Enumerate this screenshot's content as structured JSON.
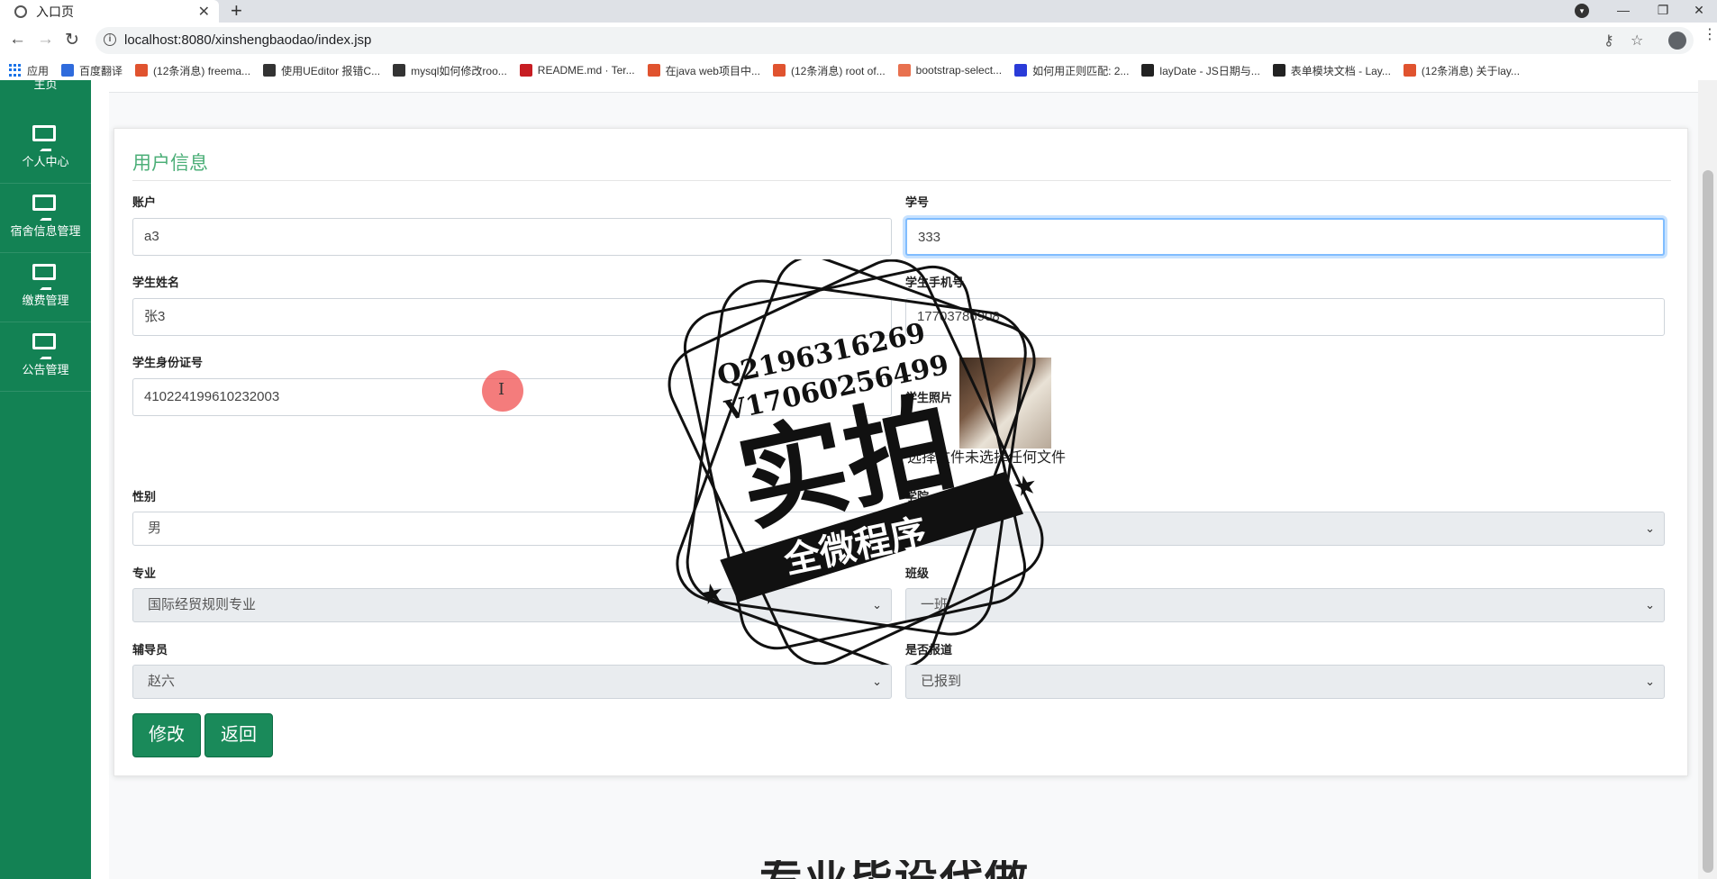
{
  "browser": {
    "tab_title": "入口页",
    "url": "localhost:8080/xinshengbaodao/index.jsp",
    "bookmarks": [
      {
        "label": "应用",
        "icon": "apps-grid-icon",
        "color": "#1a73e8"
      },
      {
        "label": "百度翻译",
        "icon": "baidu-translate-icon",
        "color": "#2f6bdc"
      },
      {
        "label": "(12条消息) freema...",
        "icon": "csdn-icon",
        "color": "#e0532f"
      },
      {
        "label": "使用UEditor 报错C...",
        "icon": "ueditor-icon",
        "color": "#333333"
      },
      {
        "label": "mysql如何修改roo...",
        "icon": "ueditor-icon",
        "color": "#333333"
      },
      {
        "label": "README.md · Ter...",
        "icon": "gitee-icon",
        "color": "#c71d23"
      },
      {
        "label": "在java web项目中...",
        "icon": "csdn-icon",
        "color": "#e0532f"
      },
      {
        "label": "(12条消息) root of...",
        "icon": "csdn-icon",
        "color": "#e0532f"
      },
      {
        "label": "bootstrap-select...",
        "icon": "jianshu-icon",
        "color": "#e8714f"
      },
      {
        "label": "如何用正则匹配: 2...",
        "icon": "baidu-paw-icon",
        "color": "#2a3bd8"
      },
      {
        "label": "layDate - JS日期与...",
        "icon": "layui-icon",
        "color": "#222222"
      },
      {
        "label": "表单模块文档 - Lay...",
        "icon": "layui-icon",
        "color": "#222222"
      },
      {
        "label": "(12条消息) 关于lay...",
        "icon": "csdn-icon",
        "color": "#e0532f"
      }
    ]
  },
  "sidebar": {
    "top_partial": "主页",
    "items": [
      {
        "label": "个人中心",
        "icon": "monitor-icon"
      },
      {
        "label": "宿舍信息管理",
        "icon": "monitor-icon"
      },
      {
        "label": "缴费管理",
        "icon": "monitor-icon"
      },
      {
        "label": "公告管理",
        "icon": "monitor-icon"
      }
    ]
  },
  "form": {
    "title": "用户信息",
    "fields": {
      "account": {
        "label": "账户",
        "value": "a3"
      },
      "student_no": {
        "label": "学号",
        "value": "333"
      },
      "name": {
        "label": "学生姓名",
        "value": "张3"
      },
      "phone": {
        "label": "学生手机号",
        "value": "17703786908"
      },
      "id_card": {
        "label": "学生身份证号",
        "value": "410224199610232003"
      },
      "photo": {
        "label": "学生照片",
        "file_button": "选择文件",
        "file_status": "未选择任何文件"
      },
      "gender": {
        "label": "性别",
        "value": "男"
      },
      "college": {
        "label": "学院",
        "value": ""
      },
      "major": {
        "label": "专业",
        "value": "国际经贸规则专业"
      },
      "class": {
        "label": "班级",
        "value": "一班"
      },
      "counselor": {
        "label": "辅导员",
        "value": "赵六"
      },
      "reported": {
        "label": "是否报道",
        "value": "已报到"
      }
    },
    "buttons": {
      "edit": "修改",
      "back": "返回"
    }
  },
  "watermark": {
    "line1": "Q2196316269",
    "line2": "V17060256499",
    "big": "实拍",
    "banner": "全微程序"
  },
  "footer_partial_text": "专业毕设代做",
  "colors": {
    "sidebar": "#138254",
    "accent": "#4caf78",
    "button": "#1a8a5a"
  }
}
